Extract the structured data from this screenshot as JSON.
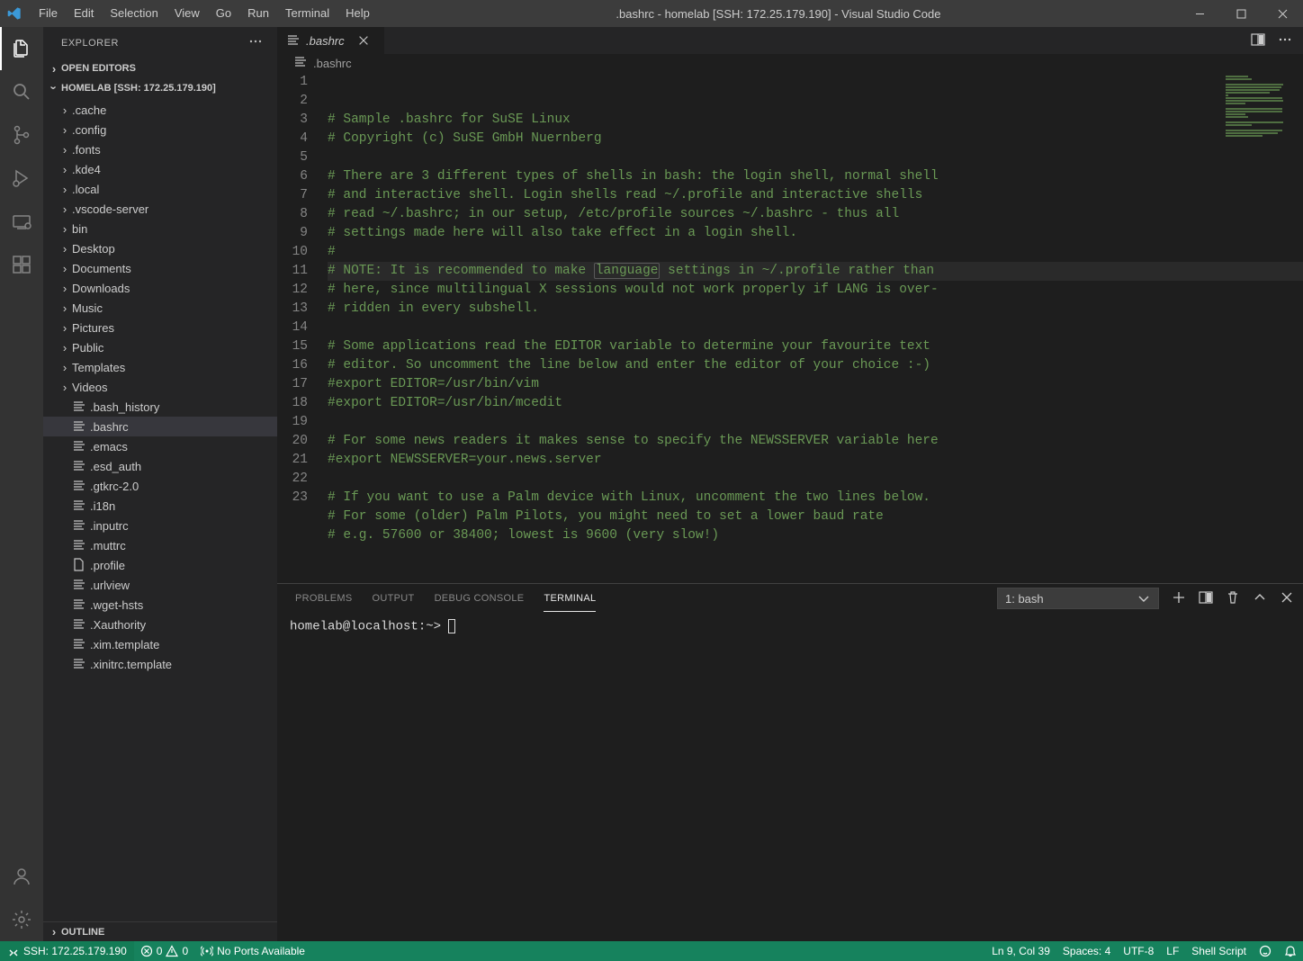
{
  "window": {
    "title": ".bashrc - homelab [SSH: 172.25.179.190] - Visual Studio Code"
  },
  "menu": [
    "File",
    "Edit",
    "Selection",
    "View",
    "Go",
    "Run",
    "Terminal",
    "Help"
  ],
  "activity": {
    "items": [
      "files",
      "search",
      "source-control",
      "run",
      "remote",
      "extensions"
    ]
  },
  "sidebar": {
    "title": "EXPLORER",
    "open_editors": "OPEN EDITORS",
    "workspace": "HOMELAB [SSH: 172.25.179.190]",
    "outline": "OUTLINE",
    "tree": [
      {
        "type": "folder",
        "label": ".cache"
      },
      {
        "type": "folder",
        "label": ".config"
      },
      {
        "type": "folder",
        "label": ".fonts"
      },
      {
        "type": "folder",
        "label": ".kde4"
      },
      {
        "type": "folder",
        "label": ".local"
      },
      {
        "type": "folder",
        "label": ".vscode-server"
      },
      {
        "type": "folder",
        "label": "bin"
      },
      {
        "type": "folder",
        "label": "Desktop"
      },
      {
        "type": "folder",
        "label": "Documents"
      },
      {
        "type": "folder",
        "label": "Downloads"
      },
      {
        "type": "folder",
        "label": "Music"
      },
      {
        "type": "folder",
        "label": "Pictures"
      },
      {
        "type": "folder",
        "label": "Public"
      },
      {
        "type": "folder",
        "label": "Templates"
      },
      {
        "type": "folder",
        "label": "Videos"
      },
      {
        "type": "file",
        "label": ".bash_history"
      },
      {
        "type": "file",
        "label": ".bashrc",
        "selected": true
      },
      {
        "type": "file",
        "label": ".emacs"
      },
      {
        "type": "file",
        "label": ".esd_auth"
      },
      {
        "type": "file",
        "label": ".gtkrc-2.0"
      },
      {
        "type": "file",
        "label": ".i18n"
      },
      {
        "type": "file",
        "label": ".inputrc"
      },
      {
        "type": "file",
        "label": ".muttrc"
      },
      {
        "type": "file",
        "label": ".profile",
        "icon": "doc"
      },
      {
        "type": "file",
        "label": ".urlview"
      },
      {
        "type": "file",
        "label": ".wget-hsts"
      },
      {
        "type": "file",
        "label": ".Xauthority"
      },
      {
        "type": "file",
        "label": ".xim.template"
      },
      {
        "type": "file",
        "label": ".xinitrc.template"
      }
    ]
  },
  "tabs": {
    "items": [
      {
        "label": ".bashrc"
      }
    ]
  },
  "breadcrumb": ".bashrc",
  "code": {
    "highlight_word": "language",
    "lines": [
      "# Sample .bashrc for SuSE Linux",
      "# Copyright (c) SuSE GmbH Nuernberg",
      "",
      "# There are 3 different types of shells in bash: the login shell, normal shell",
      "# and interactive shell. Login shells read ~/.profile and interactive shells",
      "# read ~/.bashrc; in our setup, /etc/profile sources ~/.bashrc - thus all",
      "# settings made here will also take effect in a login shell.",
      "#",
      "# NOTE: It is recommended to make language settings in ~/.profile rather than",
      "# here, since multilingual X sessions would not work properly if LANG is over-",
      "# ridden in every subshell.",
      "",
      "# Some applications read the EDITOR variable to determine your favourite text",
      "# editor. So uncomment the line below and enter the editor of your choice :-)",
      "#export EDITOR=/usr/bin/vim",
      "#export EDITOR=/usr/bin/mcedit",
      "",
      "# For some news readers it makes sense to specify the NEWSSERVER variable here",
      "#export NEWSSERVER=your.news.server",
      "",
      "# If you want to use a Palm device with Linux, uncomment the two lines below.",
      "# For some (older) Palm Pilots, you might need to set a lower baud rate",
      "# e.g. 57600 or 38400; lowest is 9600 (very slow!)"
    ],
    "highlighted_line": 9
  },
  "panel": {
    "tabs": [
      "PROBLEMS",
      "OUTPUT",
      "DEBUG CONSOLE",
      "TERMINAL"
    ],
    "active": "TERMINAL",
    "terminal_select": "1: bash",
    "prompt": "homelab@localhost:~> "
  },
  "status": {
    "remote": "SSH: 172.25.179.190",
    "errors": "0",
    "warnings": "0",
    "ports": "No Ports Available",
    "position": "Ln 9, Col 39",
    "spaces": "Spaces: 4",
    "encoding": "UTF-8",
    "eol": "LF",
    "language": "Shell Script"
  }
}
